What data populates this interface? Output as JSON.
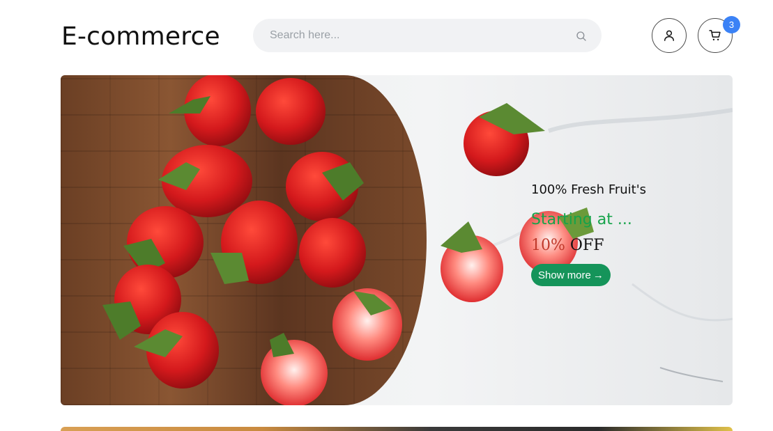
{
  "header": {
    "brand": "E-commerce",
    "search_placeholder": "Search here...",
    "cart_count": "3"
  },
  "hero": {
    "eyebrow": "100% Fresh Fruit's",
    "subtitle": "Starting at ...",
    "discount_pct": "10%",
    "discount_off": "OFF",
    "cta_label": "Show more",
    "cta_arrow": "→"
  },
  "colors": {
    "accent_green": "#15945a",
    "badge_blue": "#3b82f6",
    "strawberry_red": "#d4191c"
  },
  "icons": [
    "search-icon",
    "user-icon",
    "cart-icon",
    "arrow-right-icon"
  ]
}
